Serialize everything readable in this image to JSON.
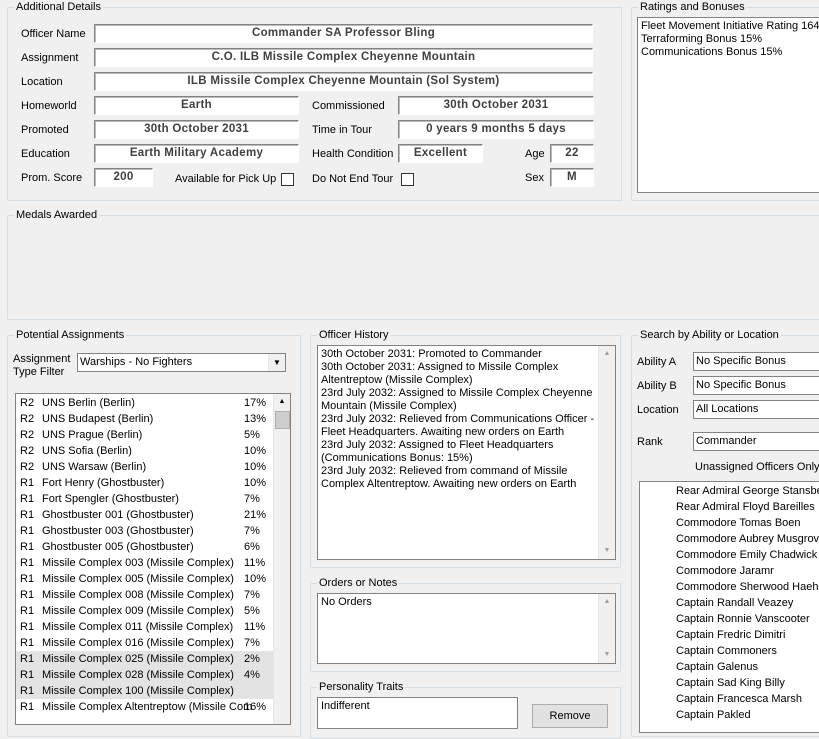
{
  "additional_details": {
    "title": "Additional Details",
    "officer_name_label": "Officer Name",
    "officer_name": "Commander SA Professor Bling",
    "assignment_label": "Assignment",
    "assignment": "C.O. ILB Missile Complex Cheyenne Mountain",
    "location_label": "Location",
    "location": "ILB Missile Complex Cheyenne Mountain (Sol System)",
    "homeworld_label": "Homeworld",
    "homeworld": "Earth",
    "commissioned_label": "Commissioned",
    "commissioned": "30th October 2031",
    "promoted_label": "Promoted",
    "promoted": "30th October 2031",
    "time_in_tour_label": "Time in Tour",
    "time_in_tour": "0 years 9 months 5 days",
    "education_label": "Education",
    "education": "Earth Military Academy",
    "health_label": "Health Condition",
    "health": "Excellent",
    "age_label": "Age",
    "age": "22",
    "prom_score_label": "Prom. Score",
    "prom_score": "200",
    "pickup_label": "Available for Pick Up",
    "pickup_checked": false,
    "not_end_tour_label": "Do Not End Tour",
    "not_end_tour_checked": false,
    "sex_label": "Sex",
    "sex": "M"
  },
  "ratings": {
    "title": "Ratings and Bonuses",
    "lines": [
      "Fleet Movement Initiative Rating 164",
      "Terraforming Bonus 15%",
      "Communications Bonus 15%"
    ]
  },
  "medals": {
    "title": "Medals Awarded"
  },
  "potential_assignments": {
    "title": "Potential Assignments",
    "filter_label_1": "Assignment",
    "filter_label_2": "Type Filter",
    "filter_value": "Warships - No Fighters",
    "rows": [
      {
        "code": "R2",
        "name": "UNS Berlin (Berlin)",
        "pct": "17%",
        "selected": false
      },
      {
        "code": "R2",
        "name": "UNS Budapest (Berlin)",
        "pct": "13%",
        "selected": false
      },
      {
        "code": "R2",
        "name": "UNS Prague (Berlin)",
        "pct": "5%",
        "selected": false
      },
      {
        "code": "R2",
        "name": "UNS Sofia (Berlin)",
        "pct": "10%",
        "selected": false
      },
      {
        "code": "R2",
        "name": "UNS Warsaw (Berlin)",
        "pct": "10%",
        "selected": false
      },
      {
        "code": "R1",
        "name": "Fort Henry (Ghostbuster)",
        "pct": "10%",
        "selected": false
      },
      {
        "code": "R1",
        "name": "Fort Spengler (Ghostbuster)",
        "pct": "7%",
        "selected": false
      },
      {
        "code": "R1",
        "name": "Ghostbuster 001 (Ghostbuster)",
        "pct": "21%",
        "selected": false
      },
      {
        "code": "R1",
        "name": "Ghostbuster 003 (Ghostbuster)",
        "pct": "7%",
        "selected": false
      },
      {
        "code": "R1",
        "name": "Ghostbuster 005 (Ghostbuster)",
        "pct": "6%",
        "selected": false
      },
      {
        "code": "R1",
        "name": "Missile Complex 003 (Missile Complex)",
        "pct": "11%",
        "selected": false
      },
      {
        "code": "R1",
        "name": "Missile Complex 005 (Missile Complex)",
        "pct": "10%",
        "selected": false
      },
      {
        "code": "R1",
        "name": "Missile Complex 008 (Missile Complex)",
        "pct": "7%",
        "selected": false
      },
      {
        "code": "R1",
        "name": "Missile Complex 009 (Missile Complex)",
        "pct": "5%",
        "selected": false
      },
      {
        "code": "R1",
        "name": "Missile Complex 011 (Missile Complex)",
        "pct": "11%",
        "selected": false
      },
      {
        "code": "R1",
        "name": "Missile Complex 016 (Missile Complex)",
        "pct": "7%",
        "selected": false
      },
      {
        "code": "R1",
        "name": "Missile Complex 025 (Missile Complex)",
        "pct": "2%",
        "selected": true
      },
      {
        "code": "R1",
        "name": "Missile Complex 028 (Missile Complex)",
        "pct": "4%",
        "selected": true
      },
      {
        "code": "R1",
        "name": "Missile Complex 100 (Missile Complex)",
        "pct": "",
        "selected": true
      },
      {
        "code": "R1",
        "name": "Missile Complex Altentreptow (Missile Com",
        "pct": "16%",
        "selected": false
      }
    ]
  },
  "officer_history": {
    "title": "Officer History",
    "lines": [
      "30th October 2031: Promoted to Commander",
      "30th October 2031: Assigned to Missile Complex",
      "Altentreptow (Missile Complex)",
      "23rd July 2032: Assigned to Missile Complex Cheyenne",
      "Mountain (Missile Complex)",
      "23rd July 2032: Relieved from Communications Officer -",
      "Fleet Headquarters. Awaiting new orders on Earth",
      "23rd July 2032: Assigned to Fleet Headquarters",
      "(Communications Bonus: 15%)",
      "23rd July 2032: Relieved from command of Missile",
      "Complex Altentreptow. Awaiting new orders on Earth"
    ]
  },
  "orders": {
    "title": "Orders or Notes",
    "text": "No Orders"
  },
  "personality": {
    "title": "Personality Traits",
    "text": "Indifferent",
    "remove_label": "Remove"
  },
  "search": {
    "title": "Search by Ability or Location",
    "ability_a_label": "Ability A",
    "ability_a": "No Specific Bonus",
    "ability_b_label": "Ability B",
    "ability_b": "No Specific Bonus",
    "location_label": "Location",
    "location": "All Locations",
    "rank_label": "Rank",
    "rank": "Commander",
    "unassigned_label": "Unassigned Officers Only",
    "officers": [
      "Rear Admiral George Stansber",
      "Rear Admiral Floyd Bareilles",
      "Commodore Tomas Boen",
      "Commodore Aubrey Musgrove",
      "Commodore Emily Chadwick",
      "Commodore Jaramr",
      "Commodore Sherwood Haehn",
      "Captain Randall Veazey",
      "Captain Ronnie Vanscooter",
      "Captain Fredric Dimitri",
      "Captain Commoners",
      "Captain Galenus",
      "Captain Sad King Billy",
      "Captain Francesca Marsh",
      "Captain Pakled"
    ]
  }
}
